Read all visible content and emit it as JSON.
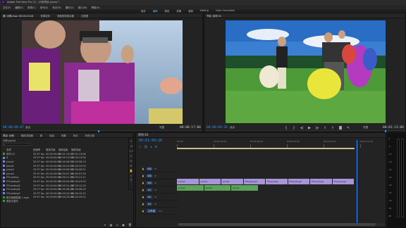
{
  "title_bar": {
    "app_label": "Pr",
    "title": "Adobe Premiere Pro CC - 示例项目.prproj *"
  },
  "menu": [
    "文件(F)",
    "编辑(E)",
    "剪辑(C)",
    "序列(S)",
    "标记(M)",
    "图形(G)",
    "窗口(W)",
    "帮助(H)"
  ],
  "workspaces": {
    "items": [
      "组件",
      "编辑",
      "颜色",
      "效果",
      "音频",
      "Editing",
      "Color Correction"
    ],
    "active_index": 1
  },
  "source_monitor": {
    "tabs": [
      "源: 示例.mov: 00:00:13:04",
      "效果控件",
      "音频剪辑混合器",
      "元数据"
    ],
    "timecode": "00:00:08:07",
    "fit_label": "适合",
    "quality_label": "完整",
    "duration": "00:00:17:00"
  },
  "program_monitor": {
    "tabs": [
      "节目: 序列 01"
    ],
    "timecode": "00:00:09:26",
    "fit_label": "适合",
    "quality_label": "完整",
    "duration": "00:01:13:08"
  },
  "project_panel": {
    "tabs": [
      "项目: 示例",
      "媒体浏览器",
      "库",
      "信息",
      "效果",
      "标记",
      "历史记录"
    ],
    "project_name": "示例.prproj",
    "search_placeholder": "",
    "columns": [
      "名称",
      "帧速率",
      "媒体开始",
      "媒体结束",
      "媒体持续"
    ],
    "rows": [
      {
        "name": "序列 01",
        "color": "#3d9a3d",
        "fps": "29.97 fps",
        "start": "00:00:00:00",
        "end": "00:01:13:07",
        "dur": "00:01:13:08"
      },
      {
        "name": "A",
        "color": "#7f86d6",
        "fps": "29.97 fps",
        "start": "00:00:00:00",
        "end": "00:00:13:03",
        "dur": "00:00:13:04"
      },
      {
        "name": "Jump1",
        "color": "#7f86d6",
        "fps": "29.97 fps",
        "start": "00:00:00:00",
        "end": "00:00:08:12",
        "dur": "00:00:08:13"
      },
      {
        "name": "Jump2",
        "color": "#7f86d6",
        "fps": "29.97 fps",
        "start": "00:00:00:00",
        "end": "00:00:10:02",
        "dur": "00:00:10:03"
      },
      {
        "name": "Jump3",
        "color": "#7f86d6",
        "fps": "29.97 fps",
        "start": "00:00:00:00",
        "end": "00:00:06:20",
        "dur": "00:00:06:21"
      },
      {
        "name": "Jump4",
        "color": "#7f86d6",
        "fps": "29.97 fps",
        "start": "00:00:00:00",
        "end": "00:00:07:15",
        "dur": "00:00:07:16"
      },
      {
        "name": "FFLanding",
        "color": "#7f86d6",
        "fps": "29.97 fps",
        "start": "00:00:00:00",
        "end": "00:00:11:10",
        "dur": "00:00:11:11"
      },
      {
        "name": "FFLanding2",
        "color": "#7f86d6",
        "fps": "29.97 fps",
        "start": "00:00:00:00",
        "end": "00:00:09:02",
        "dur": "00:00:09:03"
      },
      {
        "name": "FFLanding3",
        "color": "#7f86d6",
        "fps": "29.97 fps",
        "start": "00:00:00:00",
        "end": "00:00:12:18",
        "dur": "00:00:12:19"
      },
      {
        "name": "FFLanding4",
        "color": "#7f86d6",
        "fps": "29.97 fps",
        "start": "00:00:00:00",
        "end": "00:00:08:24",
        "dur": "00:00:08:25"
      },
      {
        "name": "FFLanding5",
        "color": "#7f86d6",
        "fps": "29.97 fps",
        "start": "00:00:00:00",
        "end": "00:00:10:14",
        "dur": "00:00:10:15"
      },
      {
        "name": "跳伞视频剪辑 1.mp4",
        "color": "#3d9a3d",
        "fps": "29.97 fps",
        "start": "00:00:00:00",
        "end": "00:00:20:00",
        "dur": "00:00:20:01"
      },
      {
        "name": "音效与音乐",
        "color": "#3d9a3d",
        "fps": "",
        "start": "",
        "end": "",
        "dur": ""
      }
    ]
  },
  "timeline": {
    "tab": "序列 01",
    "timecode": "00:01:09:26",
    "ruler_labels": [
      "00:00",
      "00:00:15:00",
      "00:00:30:00",
      "00:00:45:00",
      "00:01:00:00",
      "00:01:15:00"
    ],
    "tracks": [
      "V3",
      "V2",
      "V1",
      "A1",
      "A2",
      "A3",
      "主声道"
    ],
    "master_value": "0.0",
    "video_clips": [
      {
        "label": "Jump4",
        "color": "#a894d8"
      },
      {
        "label": "Jump2",
        "color": "#a894d8"
      },
      {
        "label": "Jump1",
        "color": "#a894d8"
      },
      {
        "label": "FFLanding3",
        "color": "#a894d8"
      },
      {
        "label": "FFLanding",
        "color": "#a894d8"
      },
      {
        "label": "FFLanding2",
        "color": "#a894d8"
      },
      {
        "label": "FFLanding5",
        "color": "#a894d8"
      },
      {
        "label": "FFLanding4",
        "color": "#a894d8"
      }
    ],
    "audio_clips": [
      {
        "label": "Jump4",
        "color": "#5aa55a"
      },
      {
        "label": "Jump2",
        "color": "#5aa55a"
      },
      {
        "label": "Jump1",
        "color": "#5aa55a"
      }
    ],
    "playhead_fraction": 0.86
  },
  "audio_meter": {
    "scale": [
      "0",
      "-6",
      "-12",
      "-18",
      "-24",
      "-30",
      "-36",
      "-42",
      "-48",
      "-54",
      "dB"
    ]
  },
  "colors": {
    "accent": "#2f8cff",
    "purple_clip": "#a894d8",
    "green_clip": "#5aa55a",
    "work_area": "#c8c08a"
  },
  "icons": [
    "play-icon",
    "step-back-icon",
    "step-forward-icon",
    "mark-in-icon",
    "mark-out-icon",
    "export-frame-icon",
    "wrench-icon",
    "selection-tool-icon",
    "razor-tool-icon",
    "hand-tool-icon",
    "zoom-tool-icon",
    "pen-tool-icon",
    "text-tool-icon"
  ]
}
